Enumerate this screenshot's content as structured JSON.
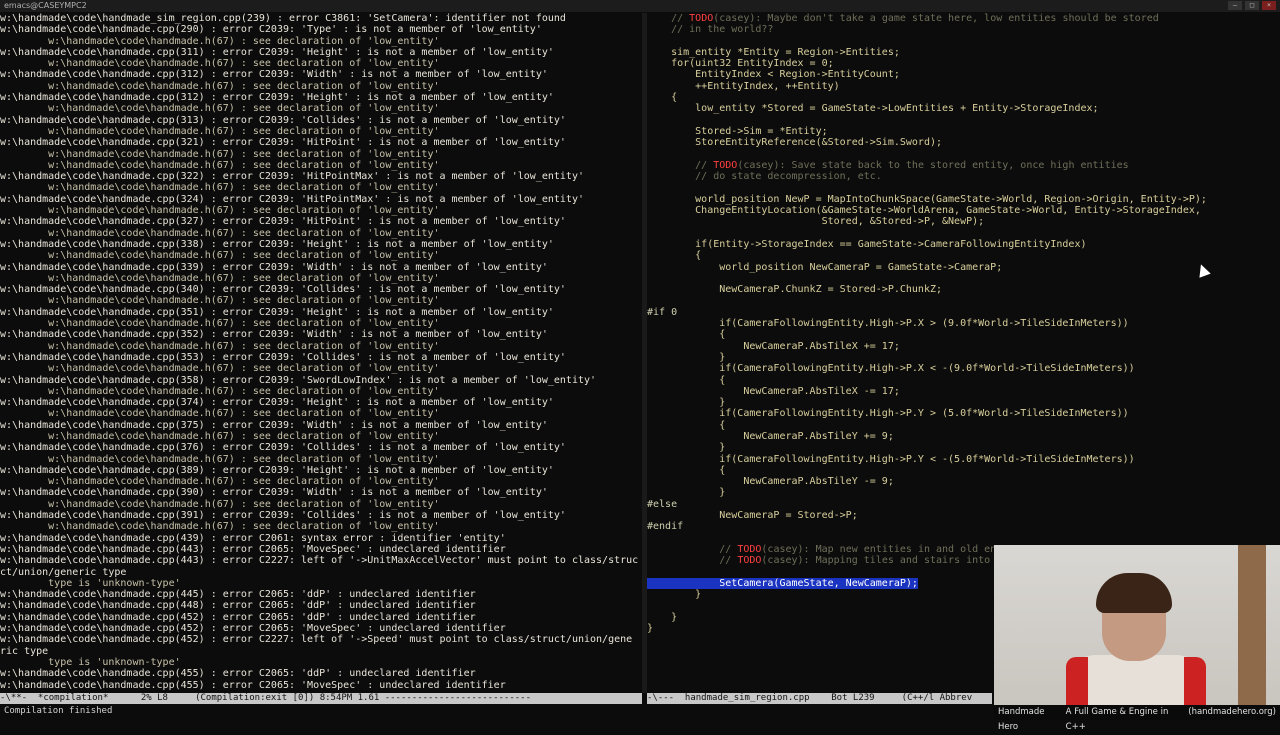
{
  "window": {
    "title": "emacs@CASEYMPC2",
    "buttons": [
      "–",
      "□",
      "×"
    ]
  },
  "compilation": {
    "lines": [
      {
        "t": "w:\\handmade\\code\\handmade_sim_region.cpp(239) : error C3861: 'SetCamera': identifier not found",
        "k": "err"
      },
      {
        "t": "w:\\handmade\\code\\handmade.cpp(290) : error C2039: 'Type' : is not a member of 'low_entity'",
        "k": "err"
      },
      {
        "t": "        w:\\handmade\\code\\handmade.h(67) : see declaration of 'low_entity'",
        "k": "see"
      },
      {
        "t": "w:\\handmade\\code\\handmade.cpp(311) : error C2039: 'Height' : is not a member of 'low_entity'",
        "k": "err"
      },
      {
        "t": "        w:\\handmade\\code\\handmade.h(67) : see declaration of 'low_entity'",
        "k": "see"
      },
      {
        "t": "w:\\handmade\\code\\handmade.cpp(312) : error C2039: 'Width' : is not a member of 'low_entity'",
        "k": "err"
      },
      {
        "t": "        w:\\handmade\\code\\handmade.h(67) : see declaration of 'low_entity'",
        "k": "see"
      },
      {
        "t": "w:\\handmade\\code\\handmade.cpp(312) : error C2039: 'Height' : is not a member of 'low_entity'",
        "k": "err"
      },
      {
        "t": "        w:\\handmade\\code\\handmade.h(67) : see declaration of 'low_entity'",
        "k": "see"
      },
      {
        "t": "w:\\handmade\\code\\handmade.cpp(313) : error C2039: 'Collides' : is not a member of 'low_entity'",
        "k": "err"
      },
      {
        "t": "        w:\\handmade\\code\\handmade.h(67) : see declaration of 'low_entity'",
        "k": "see"
      },
      {
        "t": "w:\\handmade\\code\\handmade.cpp(321) : error C2039: 'HitPoint' : is not a member of 'low_entity'",
        "k": "err"
      },
      {
        "t": "        w:\\handmade\\code\\handmade.h(67) : see declaration of 'low_entity'",
        "k": "see"
      },
      {
        "t": "        w:\\handmade\\code\\handmade.h(67) : see declaration of 'low_entity'",
        "k": "see"
      },
      {
        "t": "w:\\handmade\\code\\handmade.cpp(322) : error C2039: 'HitPointMax' : is not a member of 'low_entity'",
        "k": "err"
      },
      {
        "t": "        w:\\handmade\\code\\handmade.h(67) : see declaration of 'low_entity'",
        "k": "see"
      },
      {
        "t": "w:\\handmade\\code\\handmade.cpp(324) : error C2039: 'HitPointMax' : is not a member of 'low_entity'",
        "k": "err"
      },
      {
        "t": "        w:\\handmade\\code\\handmade.h(67) : see declaration of 'low_entity'",
        "k": "see"
      },
      {
        "t": "w:\\handmade\\code\\handmade.cpp(327) : error C2039: 'HitPoint' : is not a member of 'low_entity'",
        "k": "err"
      },
      {
        "t": "        w:\\handmade\\code\\handmade.h(67) : see declaration of 'low_entity'",
        "k": "see"
      },
      {
        "t": "w:\\handmade\\code\\handmade.cpp(338) : error C2039: 'Height' : is not a member of 'low_entity'",
        "k": "err"
      },
      {
        "t": "        w:\\handmade\\code\\handmade.h(67) : see declaration of 'low_entity'",
        "k": "see"
      },
      {
        "t": "w:\\handmade\\code\\handmade.cpp(339) : error C2039: 'Width' : is not a member of 'low_entity'",
        "k": "err"
      },
      {
        "t": "        w:\\handmade\\code\\handmade.h(67) : see declaration of 'low_entity'",
        "k": "see"
      },
      {
        "t": "w:\\handmade\\code\\handmade.cpp(340) : error C2039: 'Collides' : is not a member of 'low_entity'",
        "k": "err"
      },
      {
        "t": "        w:\\handmade\\code\\handmade.h(67) : see declaration of 'low_entity'",
        "k": "see"
      },
      {
        "t": "w:\\handmade\\code\\handmade.cpp(351) : error C2039: 'Height' : is not a member of 'low_entity'",
        "k": "err"
      },
      {
        "t": "        w:\\handmade\\code\\handmade.h(67) : see declaration of 'low_entity'",
        "k": "see"
      },
      {
        "t": "w:\\handmade\\code\\handmade.cpp(352) : error C2039: 'Width' : is not a member of 'low_entity'",
        "k": "err"
      },
      {
        "t": "        w:\\handmade\\code\\handmade.h(67) : see declaration of 'low_entity'",
        "k": "see"
      },
      {
        "t": "w:\\handmade\\code\\handmade.cpp(353) : error C2039: 'Collides' : is not a member of 'low_entity'",
        "k": "err"
      },
      {
        "t": "        w:\\handmade\\code\\handmade.h(67) : see declaration of 'low_entity'",
        "k": "see"
      },
      {
        "t": "w:\\handmade\\code\\handmade.cpp(358) : error C2039: 'SwordLowIndex' : is not a member of 'low_entity'",
        "k": "err"
      },
      {
        "t": "        w:\\handmade\\code\\handmade.h(67) : see declaration of 'low_entity'",
        "k": "see"
      },
      {
        "t": "w:\\handmade\\code\\handmade.cpp(374) : error C2039: 'Height' : is not a member of 'low_entity'",
        "k": "err"
      },
      {
        "t": "        w:\\handmade\\code\\handmade.h(67) : see declaration of 'low_entity'",
        "k": "see"
      },
      {
        "t": "w:\\handmade\\code\\handmade.cpp(375) : error C2039: 'Width' : is not a member of 'low_entity'",
        "k": "err"
      },
      {
        "t": "        w:\\handmade\\code\\handmade.h(67) : see declaration of 'low_entity'",
        "k": "see"
      },
      {
        "t": "w:\\handmade\\code\\handmade.cpp(376) : error C2039: 'Collides' : is not a member of 'low_entity'",
        "k": "err"
      },
      {
        "t": "        w:\\handmade\\code\\handmade.h(67) : see declaration of 'low_entity'",
        "k": "see"
      },
      {
        "t": "w:\\handmade\\code\\handmade.cpp(389) : error C2039: 'Height' : is not a member of 'low_entity'",
        "k": "err"
      },
      {
        "t": "        w:\\handmade\\code\\handmade.h(67) : see declaration of 'low_entity'",
        "k": "see"
      },
      {
        "t": "w:\\handmade\\code\\handmade.cpp(390) : error C2039: 'Width' : is not a member of 'low_entity'",
        "k": "err"
      },
      {
        "t": "        w:\\handmade\\code\\handmade.h(67) : see declaration of 'low_entity'",
        "k": "see"
      },
      {
        "t": "w:\\handmade\\code\\handmade.cpp(391) : error C2039: 'Collides' : is not a member of 'low_entity'",
        "k": "err"
      },
      {
        "t": "        w:\\handmade\\code\\handmade.h(67) : see declaration of 'low_entity'",
        "k": "see"
      },
      {
        "t": "w:\\handmade\\code\\handmade.cpp(439) : error C2061: syntax error : identifier 'entity'",
        "k": "err"
      },
      {
        "t": "w:\\handmade\\code\\handmade.cpp(443) : error C2065: 'MoveSpec' : undeclared identifier",
        "k": "err"
      },
      {
        "t": "w:\\handmade\\code\\handmade.cpp(443) : error C2227: left of '->UnitMaxAccelVector' must point to class/struc",
        "k": "err"
      },
      {
        "t": "ct/union/generic type",
        "k": "err"
      },
      {
        "t": "        type is 'unknown-type'",
        "k": "see"
      },
      {
        "t": "w:\\handmade\\code\\handmade.cpp(445) : error C2065: 'ddP' : undeclared identifier",
        "k": "err"
      },
      {
        "t": "w:\\handmade\\code\\handmade.cpp(448) : error C2065: 'ddP' : undeclared identifier",
        "k": "err"
      },
      {
        "t": "w:\\handmade\\code\\handmade.cpp(452) : error C2065: 'ddP' : undeclared identifier",
        "k": "err"
      },
      {
        "t": "w:\\handmade\\code\\handmade.cpp(452) : error C2065: 'MoveSpec' : undeclared identifier",
        "k": "err"
      },
      {
        "t": "w:\\handmade\\code\\handmade.cpp(452) : error C2227: left of '->Speed' must point to class/struct/union/gene",
        "k": "err"
      },
      {
        "t": "ric type",
        "k": "err"
      },
      {
        "t": "        type is 'unknown-type'",
        "k": "see"
      },
      {
        "t": "w:\\handmade\\code\\handmade.cpp(455) : error C2065: 'ddP' : undeclared identifier",
        "k": "err"
      },
      {
        "t": "w:\\handmade\\code\\handmade.cpp(455) : error C2065: 'MoveSpec' : undeclared identifier",
        "k": "err"
      }
    ]
  },
  "source": {
    "lines": [
      {
        "t": "    // TODO(casey): Maybe don't take a game state here, low entities should be stored",
        "k": "comment-todo",
        "todo": "TODO"
      },
      {
        "t": "    // in the world??",
        "k": "comment"
      },
      {
        "t": "",
        "k": "code"
      },
      {
        "t": "    sim_entity *Entity = Region->Entities;",
        "k": "code"
      },
      {
        "t": "    for(uint32 EntityIndex = 0;",
        "k": "code"
      },
      {
        "t": "        EntityIndex < Region->EntityCount;",
        "k": "code"
      },
      {
        "t": "        ++EntityIndex, ++Entity)",
        "k": "code"
      },
      {
        "t": "    {",
        "k": "code"
      },
      {
        "t": "        low_entity *Stored = GameState->LowEntities + Entity->StorageIndex;",
        "k": "code"
      },
      {
        "t": "",
        "k": "code"
      },
      {
        "t": "        Stored->Sim = *Entity;",
        "k": "code"
      },
      {
        "t": "        StoreEntityReference(&Stored->Sim.Sword);",
        "k": "code"
      },
      {
        "t": "",
        "k": "code"
      },
      {
        "t": "        // TODO(casey): Save state back to the stored entity, once high entities",
        "k": "comment-todo",
        "todo": "TODO"
      },
      {
        "t": "        // do state decompression, etc.",
        "k": "comment"
      },
      {
        "t": "",
        "k": "code"
      },
      {
        "t": "        world_position NewP = MapIntoChunkSpace(GameState->World, Region->Origin, Entity->P);",
        "k": "code"
      },
      {
        "t": "        ChangeEntityLocation(&GameState->WorldArena, GameState->World, Entity->StorageIndex,",
        "k": "code"
      },
      {
        "t": "                             Stored, &Stored->P, &NewP);",
        "k": "code"
      },
      {
        "t": "",
        "k": "code"
      },
      {
        "t": "        if(Entity->StorageIndex == GameState->CameraFollowingEntityIndex)",
        "k": "code"
      },
      {
        "t": "        {",
        "k": "code"
      },
      {
        "t": "            world_position NewCameraP = GameState->CameraP;",
        "k": "code"
      },
      {
        "t": "",
        "k": "code"
      },
      {
        "t": "            NewCameraP.ChunkZ = Stored->P.ChunkZ;",
        "k": "code"
      },
      {
        "t": "",
        "k": "code"
      },
      {
        "t": "#if 0",
        "k": "pre"
      },
      {
        "t": "            if(CameraFollowingEntity.High->P.X > (9.0f*World->TileSideInMeters))",
        "k": "code"
      },
      {
        "t": "            {",
        "k": "code"
      },
      {
        "t": "                NewCameraP.AbsTileX += 17;",
        "k": "code"
      },
      {
        "t": "            }",
        "k": "code"
      },
      {
        "t": "            if(CameraFollowingEntity.High->P.X < -(9.0f*World->TileSideInMeters))",
        "k": "code"
      },
      {
        "t": "            {",
        "k": "code"
      },
      {
        "t": "                NewCameraP.AbsTileX -= 17;",
        "k": "code"
      },
      {
        "t": "            }",
        "k": "code"
      },
      {
        "t": "            if(CameraFollowingEntity.High->P.Y > (5.0f*World->TileSideInMeters))",
        "k": "code"
      },
      {
        "t": "            {",
        "k": "code"
      },
      {
        "t": "                NewCameraP.AbsTileY += 9;",
        "k": "code"
      },
      {
        "t": "            }",
        "k": "code"
      },
      {
        "t": "            if(CameraFollowingEntity.High->P.Y < -(5.0f*World->TileSideInMeters))",
        "k": "code"
      },
      {
        "t": "            {",
        "k": "code"
      },
      {
        "t": "                NewCameraP.AbsTileY -= 9;",
        "k": "code"
      },
      {
        "t": "            }",
        "k": "code"
      },
      {
        "t": "#else",
        "k": "pre"
      },
      {
        "t": "            NewCameraP = Stored->P;",
        "k": "code"
      },
      {
        "t": "#endif",
        "k": "pre"
      },
      {
        "t": "",
        "k": "code"
      },
      {
        "t": "            // TODO(casey): Map new entities in and old en",
        "k": "comment-todo",
        "todo": "TODO"
      },
      {
        "t": "            // TODO(casey): Mapping tiles and stairs into",
        "k": "comment-todo",
        "todo": "TODO"
      },
      {
        "t": "",
        "k": "code"
      },
      {
        "t": "            SetCamera(GameState, NewCameraP);",
        "k": "highlight"
      },
      {
        "t": "        }",
        "k": "code"
      },
      {
        "t": "",
        "k": "code"
      },
      {
        "t": "    }",
        "k": "code"
      },
      {
        "t": "}",
        "k": "code"
      }
    ]
  },
  "modeline_left": "-\\**-  *compilation*      2% L8     (Compilation:exit [0]) 8:54PM 1.61 ---------------------------",
  "modeline_right": "-\\---  handmade_sim_region.cpp    Bot L239     (C++/l Abbrev",
  "minibuffer": "Compilation finished",
  "webcam_caption": {
    "left": "Handmade Hero",
    "center": "A Full Game & Engine in C++",
    "right": "(handmadehero.org)"
  }
}
